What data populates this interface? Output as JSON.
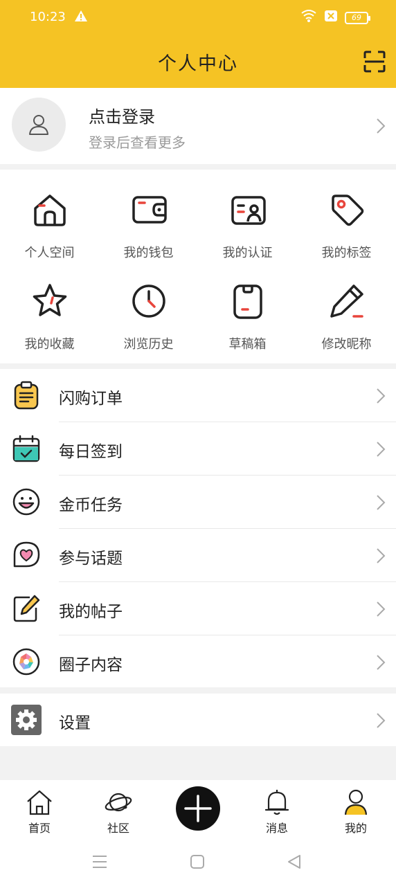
{
  "status_bar": {
    "time": "10:23",
    "battery": "69"
  },
  "header": {
    "title": "个人中心"
  },
  "profile": {
    "title": "点击登录",
    "subtitle": "登录后查看更多"
  },
  "grid": [
    {
      "label": "个人空间",
      "icon": "home-icon"
    },
    {
      "label": "我的钱包",
      "icon": "wallet-icon"
    },
    {
      "label": "我的认证",
      "icon": "id-card-icon"
    },
    {
      "label": "我的标签",
      "icon": "tag-icon"
    },
    {
      "label": "我的收藏",
      "icon": "star-icon"
    },
    {
      "label": "浏览历史",
      "icon": "clock-icon"
    },
    {
      "label": "草稿箱",
      "icon": "draft-icon"
    },
    {
      "label": "修改昵称",
      "icon": "pen-icon"
    }
  ],
  "menu": [
    {
      "label": "闪购订单",
      "icon": "clipboard-icon"
    },
    {
      "label": "每日签到",
      "icon": "calendar-check-icon"
    },
    {
      "label": "金币任务",
      "icon": "smiley-icon"
    },
    {
      "label": "参与话题",
      "icon": "heart-bubble-icon"
    },
    {
      "label": "我的帖子",
      "icon": "edit-note-icon"
    },
    {
      "label": "圈子内容",
      "icon": "aperture-icon"
    }
  ],
  "settings": {
    "label": "设置",
    "icon": "gear-icon"
  },
  "tabbar": [
    {
      "label": "首页",
      "icon": "home-tab-icon"
    },
    {
      "label": "社区",
      "icon": "planet-icon"
    },
    {
      "label": "消息",
      "icon": "bell-icon"
    },
    {
      "label": "我的",
      "icon": "user-tab-icon"
    }
  ],
  "colors": {
    "accent": "#f5c324",
    "red": "#e8453c",
    "teal": "#3ec7b5"
  }
}
